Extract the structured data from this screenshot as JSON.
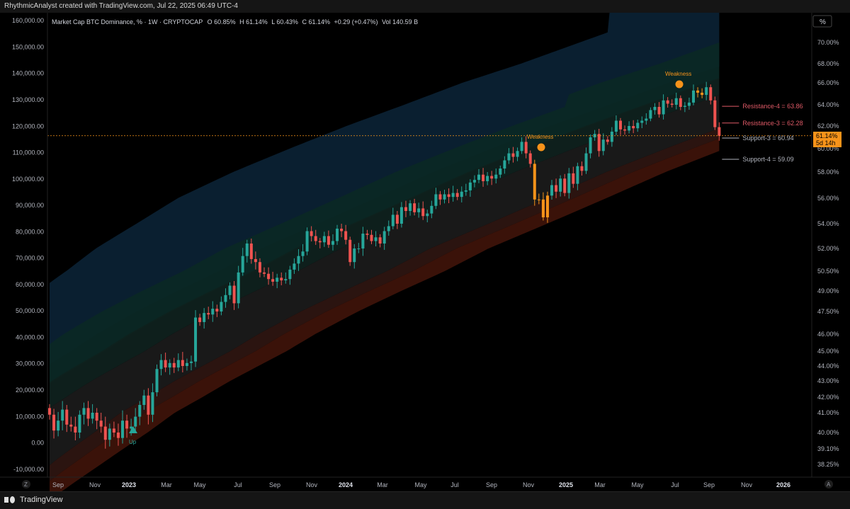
{
  "header": {
    "attribution": "RhythmicAnalyst created with TradingView.com, Jul 22, 2025 06:49 UTC-4"
  },
  "legend": {
    "symbol": "Market Cap BTC Dominance, % · 1W · CRYPTOCAP",
    "o_label": "O",
    "o_value": "60.85%",
    "h_label": "H",
    "h_value": "61.14%",
    "l_label": "L",
    "l_value": "60.43%",
    "c_label": "C",
    "c_value": "61.14%",
    "change": "+0.29 (+0.47%)",
    "vol_label": "Vol",
    "vol_value": "140.59 B"
  },
  "footer": {
    "brand": "TradingView",
    "z_button": "Z",
    "a_button": "A"
  },
  "price_badge": {
    "value": "61.14%",
    "countdown": "5d 14h"
  },
  "percent_axis_title": "%",
  "colors": {
    "up": "#26a69a",
    "down": "#ef5350",
    "weakness": "#f7931a",
    "resistance": "#e05a67",
    "support": "#b2b5be",
    "accent": "#f7931a"
  },
  "chart_data": {
    "type": "candlestick",
    "x_ticks": [
      "Sep",
      "Nov",
      "2023",
      "Mar",
      "May",
      "Jul",
      "Sep",
      "Nov",
      "2024",
      "Mar",
      "May",
      "Jul",
      "Sep",
      "Nov",
      "2025",
      "Mar",
      "May",
      "Jul",
      "Sep",
      "Nov",
      "2026"
    ],
    "left_axis": {
      "ticks": [
        "160,000.00",
        "150,000.00",
        "140,000.00",
        "130,000.00",
        "120,000.00",
        "110,000.00",
        "100,000.00",
        "90,000.00",
        "80,000.00",
        "70,000.00",
        "60,000.00",
        "50,000.00",
        "40,000.00",
        "30,000.00",
        "20,000.00",
        "10,000.00",
        "0.00",
        "-10,000.00"
      ],
      "range": [
        -13000,
        163000
      ]
    },
    "right_axis": {
      "unit": "%",
      "log": true,
      "ticks": [
        "70.00%",
        "68.00%",
        "66.00%",
        "64.00%",
        "62.00%",
        "60.00%",
        "58.00%",
        "56.00%",
        "54.00%",
        "52.00%",
        "50.50%",
        "49.00%",
        "47.50%",
        "46.00%",
        "45.00%",
        "44.00%",
        "43.00%",
        "42.00%",
        "41.00%",
        "40.00%",
        "39.10%",
        "38.25%"
      ]
    },
    "annotations": [
      {
        "text": "Up",
        "date": "2022-12-26",
        "kind": "up-signal"
      },
      {
        "text": "Weakness",
        "date": "2024-11-18",
        "kind": "weakness"
      },
      {
        "text": "Weakness",
        "date": "2025-07-07",
        "kind": "weakness"
      }
    ],
    "levels": [
      {
        "label": "Resistance-4 =",
        "value": "63.86",
        "kind": "resistance"
      },
      {
        "label": "Resistance-3 =",
        "value": "62.28",
        "kind": "resistance"
      },
      {
        "label": "Support-3 =",
        "value": "60.94",
        "kind": "support"
      },
      {
        "label": "Support-4 =",
        "value": "59.09",
        "kind": "support"
      }
    ],
    "current_value": 61.14
  }
}
